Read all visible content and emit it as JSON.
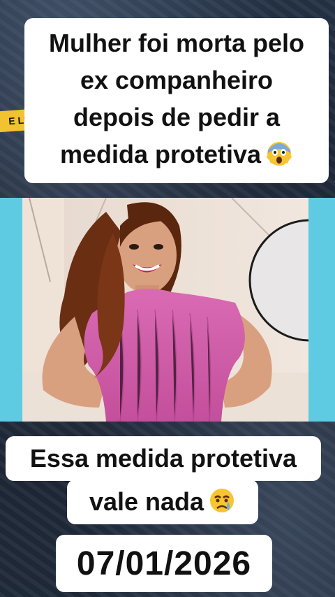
{
  "headline": {
    "line1": "Mulher foi morta pelo",
    "line2": "ex companheiro",
    "line3": "depois de pedir a",
    "line4": "medida protetiva",
    "emoji": "screaming-face-emoji"
  },
  "caption": {
    "line1": "Essa medida protetiva",
    "line2": "vale nada",
    "emoji": "crying-face-emoji"
  },
  "date": "07/01/2026",
  "colors": {
    "frame_cyan": "#5ecbe2",
    "blouse_pink": "#d25aa8",
    "caption_bg": "#ffffff",
    "text": "#111111"
  }
}
